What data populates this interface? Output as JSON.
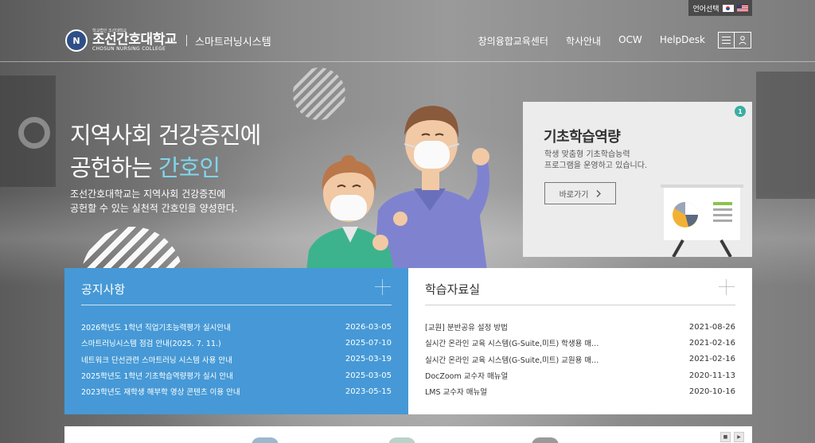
{
  "language": {
    "label": "언어선택",
    "flags": [
      "flag-kr-icon",
      "flag-us-icon"
    ]
  },
  "header": {
    "logo_tiny": "학교법인 조선대학교",
    "logo_ko": "조선간호대학교",
    "logo_en": "CHOSUN NURSING COLLEGE",
    "logo_emblem": "N",
    "subtitle": "스마트러닝시스템",
    "nav": [
      "창의융합교육센터",
      "학사안내",
      "OCW",
      "HelpDesk"
    ],
    "icons": [
      "menu-icon",
      "user-icon"
    ]
  },
  "hero": {
    "title_line1": "지역사회 건강증진에",
    "title_line2_prefix": "공헌하는 ",
    "title_line2_accent": "간호인",
    "desc_line1": "조선간호대학교는 지역사회 건강증진에",
    "desc_line2": "공헌할 수 있는 실천적 간호인을 양성한다."
  },
  "promo": {
    "badge": "1",
    "title": "기초학습역량",
    "desc_line1": "학생 맞춤형 기초학습능력",
    "desc_line2": "프로그램을 운영하고 있습니다.",
    "button_label": "바로가기",
    "button_icon": "chevron-right-icon"
  },
  "notice": {
    "title": "공지사항",
    "items": [
      {
        "title": "2026학년도 1학년 직업기초능력평가 실시안내",
        "date": "2026-03-05"
      },
      {
        "title": "스마트러닝시스템 점검 안내(2025. 7. 11.)",
        "date": "2025-07-10"
      },
      {
        "title": "네트워크 단선관련 스마트러닝 시스템 사용 안내",
        "date": "2025-03-19"
      },
      {
        "title": "2025학년도 1학년 기초학습역량평가 실시 안내",
        "date": "2025-03-05"
      },
      {
        "title": "2023학년도 재학생 해부학 영상 콘텐츠 이용 안내",
        "date": "2023-05-15"
      }
    ]
  },
  "library": {
    "title": "학습자료실",
    "items": [
      {
        "title": "[교원] 분반공유 설정 방법",
        "date": "2021-08-26"
      },
      {
        "title": "실시간 온라인 교육 시스템(G-Suite,미트) 학생용 매...",
        "date": "2021-02-16"
      },
      {
        "title": "실시간 온라인 교육 시스템(G-Suite,미트) 교원용 매...",
        "date": "2021-02-16"
      },
      {
        "title": "DocZoom 교수자 매뉴얼",
        "date": "2020-11-13"
      },
      {
        "title": "LMS 교수자 매뉴얼",
        "date": "2020-10-16"
      }
    ]
  },
  "colors": {
    "notice_bg": "#4699d6",
    "accent_text": "#7fd6ec",
    "badge": "#3aaea3",
    "promo_bg": "#ececec"
  }
}
